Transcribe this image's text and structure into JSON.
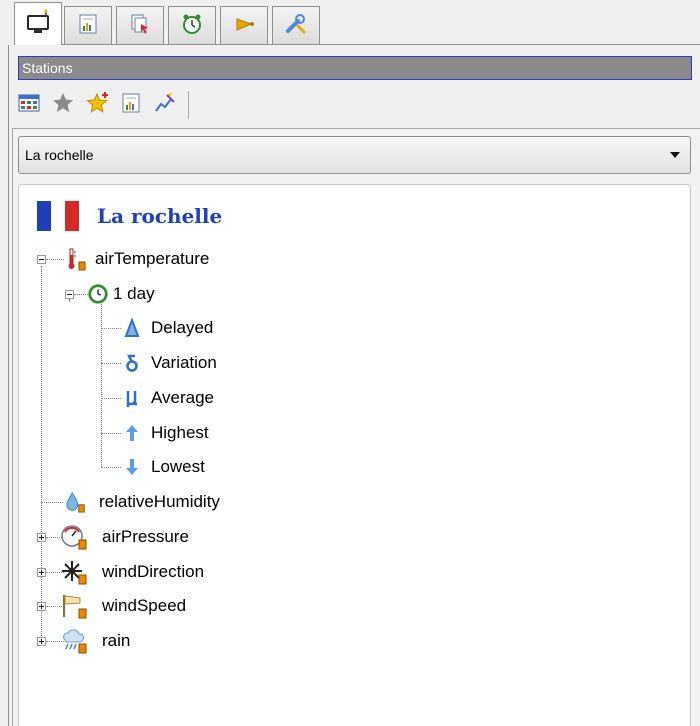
{
  "tabs": [
    {
      "icon": "station-monitor-icon",
      "active": true
    },
    {
      "icon": "report-chart-icon",
      "active": false
    },
    {
      "icon": "pages-cursor-icon",
      "active": false
    },
    {
      "icon": "alarm-clock-icon",
      "active": false
    },
    {
      "icon": "bell-icon",
      "active": false
    },
    {
      "icon": "tools-icon",
      "active": false
    }
  ],
  "panel": {
    "title": "Stations"
  },
  "toolbar": [
    {
      "icon": "grid-table-icon"
    },
    {
      "icon": "star-gray-icon"
    },
    {
      "icon": "star-add-icon"
    },
    {
      "icon": "report-icon"
    },
    {
      "icon": "magic-wand-chart-icon"
    }
  ],
  "station_select": {
    "value": "La rochelle"
  },
  "tree": {
    "station": "La rochelle",
    "flag_colors": [
      "#1d3fbf",
      "#ffffff",
      "#d62828"
    ],
    "nodes": [
      {
        "label": "airTemperature",
        "icon": "thermometer-icon",
        "expanded": true
      },
      {
        "label": "1 day",
        "icon": "clock-refresh-icon",
        "expanded": true
      },
      {
        "label": "Delayed",
        "icon": "delta-icon"
      },
      {
        "label": "Variation",
        "icon": "delta-small-icon"
      },
      {
        "label": "Average",
        "icon": "mu-icon"
      },
      {
        "label": "Highest",
        "icon": "arrow-up-icon"
      },
      {
        "label": "Lowest",
        "icon": "arrow-down-icon"
      },
      {
        "label": "relativeHumidity",
        "icon": "water-drop-icon"
      },
      {
        "label": "airPressure",
        "icon": "barometer-icon",
        "expanded": false
      },
      {
        "label": "windDirection",
        "icon": "compass-rose-icon",
        "expanded": false
      },
      {
        "label": "windSpeed",
        "icon": "windsock-icon",
        "expanded": false
      },
      {
        "label": "rain",
        "icon": "rain-cloud-icon",
        "expanded": false
      }
    ]
  }
}
